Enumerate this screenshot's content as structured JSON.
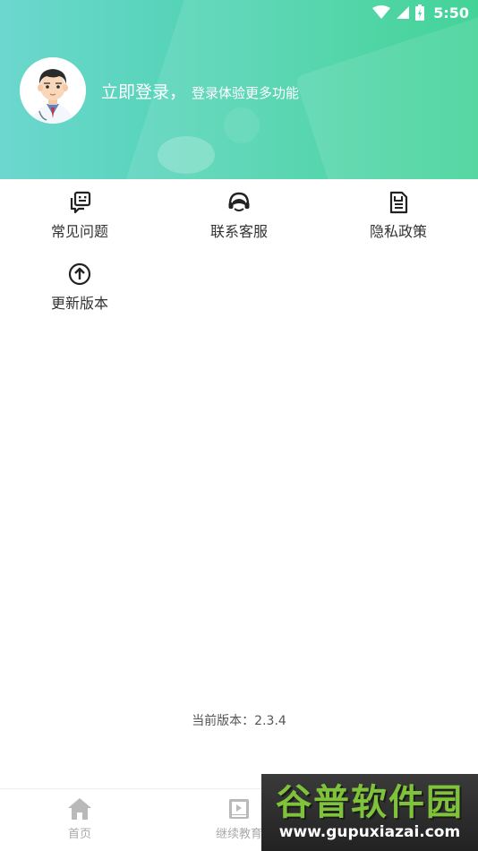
{
  "status_bar": {
    "time": "5:50"
  },
  "profile": {
    "login_main": "立即登录，",
    "login_sub": "登录体验更多功能"
  },
  "menu": {
    "items": [
      {
        "label": "常见问题",
        "icon": "faq-icon"
      },
      {
        "label": "联系客服",
        "icon": "headset-icon"
      },
      {
        "label": "隐私政策",
        "icon": "document-icon"
      },
      {
        "label": "更新版本",
        "icon": "upload-arrow-icon"
      }
    ]
  },
  "footer": {
    "version_text": "当前版本：2.3.4"
  },
  "bottom_nav": {
    "items": [
      {
        "label": "首页",
        "icon": "home-icon"
      },
      {
        "label": "继续教育",
        "icon": "book-icon"
      },
      {
        "label": "",
        "icon": "profile-icon"
      }
    ]
  },
  "watermark": {
    "title": "谷普软件园",
    "url": "www.gupuxiazai.com"
  },
  "colors": {
    "header_start": "#6cd7cf",
    "header_end": "#2ecf8c",
    "text_primary": "#333333",
    "nav_inactive": "#aaaaaa",
    "watermark_green": "#7fc33a"
  }
}
